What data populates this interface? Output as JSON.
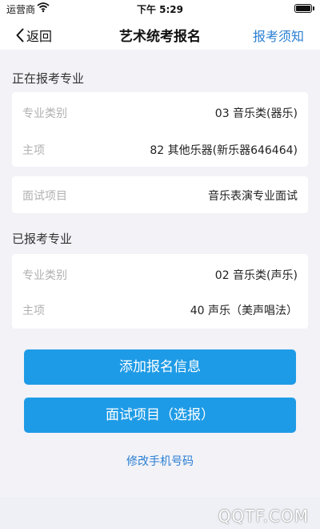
{
  "status_bar": {
    "carrier": "运营商",
    "time": "下午 5:29"
  },
  "nav": {
    "back_label": "返回",
    "title": "艺术统考报名",
    "right_link": "报考须知"
  },
  "current": {
    "section_title": "正在报考专业",
    "category_label": "专业类别",
    "category_value": "03 音乐类(器乐)",
    "main_label": "主项",
    "main_value": "82 其他乐器(新乐器646464)",
    "interview_label": "面试项目",
    "interview_value": "音乐表演专业面试"
  },
  "registered": {
    "section_title": "已报考专业",
    "category_label": "专业类别",
    "category_value": "02 音乐类(声乐)",
    "main_label": "主项",
    "main_value": "40 声乐（美声唱法）"
  },
  "actions": {
    "add_info": "添加报名信息",
    "interview_select": "面试项目（选报）",
    "change_phone": "修改手机号码"
  },
  "watermark": "QQTF.COM",
  "colors": {
    "primary_button": "#1e9be6",
    "link": "#2a7fd3",
    "background": "#f2f2f7"
  }
}
